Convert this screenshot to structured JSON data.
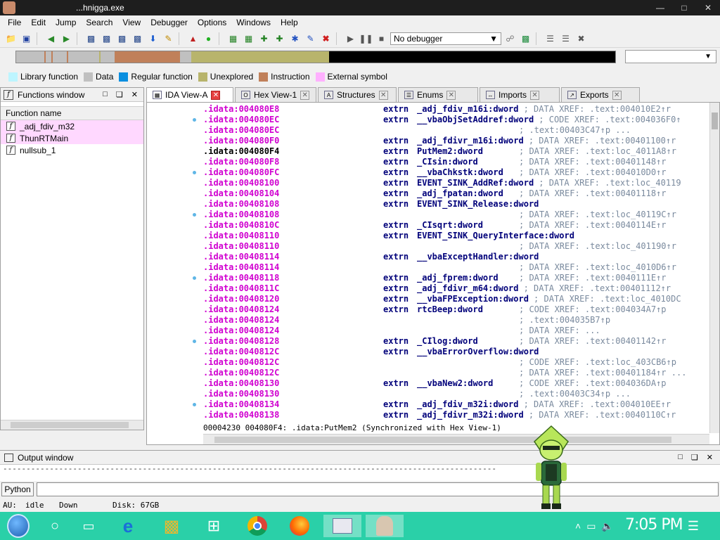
{
  "window": {
    "title": "...hnigga.exe"
  },
  "menu": [
    "File",
    "Edit",
    "Jump",
    "Search",
    "View",
    "Debugger",
    "Options",
    "Windows",
    "Help"
  ],
  "toolbar": {
    "debugger": "No debugger"
  },
  "legend": [
    {
      "label": "Library function",
      "color": "#bdf5ff"
    },
    {
      "label": "Data",
      "color": "#c0c0c0"
    },
    {
      "label": "Regular function",
      "color": "#0a8fe0"
    },
    {
      "label": "Unexplored",
      "color": "#b8b46c"
    },
    {
      "label": "Instruction",
      "color": "#c0805a"
    },
    {
      "label": "External symbol",
      "color": "#ffb0ff"
    }
  ],
  "functions_window": {
    "title": "Functions window",
    "column": "Function name",
    "items": [
      "_adj_fdiv_m32",
      "ThunRTMain",
      "nullsub_1"
    ]
  },
  "tabs": [
    "IDA View-A",
    "Hex View-1",
    "Structures",
    "Enums",
    "Imports",
    "Exports"
  ],
  "code_lines": [
    {
      "addr": ".idata:004080E8",
      "mnem": "extrn",
      "name": "_adj_fdiv_m16i:dword",
      "xref": "; DATA XREF: .text:004010E2↑r",
      "xref_pos": "after"
    },
    {
      "addr": ".idata:004080EC",
      "mnem": "extrn",
      "name": "__vbaObjSetAddref:dword",
      "xref": "; CODE XREF: .text:004036F0↑",
      "xref_pos": "after"
    },
    {
      "addr": ".idata:004080EC",
      "mnem": "",
      "name": "",
      "xref": "; .text:00403C47↑p ...",
      "xref_pos": "col"
    },
    {
      "addr": ".idata:004080F0",
      "mnem": "extrn",
      "name": "_adj_fdivr_m16i:dword",
      "xref": "; DATA XREF: .text:00401100↑r",
      "xref_pos": "after"
    },
    {
      "addr": ".idata:004080F4",
      "mnem": "extrn",
      "name": "PutMem2:dword",
      "xref": "; DATA XREF: .text:loc_4011A8↑r",
      "xref_pos": "col",
      "cursor": true
    },
    {
      "addr": ".idata:004080F8",
      "mnem": "extrn",
      "name": "_CIsin:dword",
      "xref": "; DATA XREF: .text:00401148↑r",
      "xref_pos": "col"
    },
    {
      "addr": ".idata:004080FC",
      "mnem": "extrn",
      "name": "__vbaChkstk:dword",
      "xref": "; DATA XREF: .text:004010D0↑r",
      "xref_pos": "col"
    },
    {
      "addr": ".idata:00408100",
      "mnem": "extrn",
      "name": "EVENT_SINK_AddRef:dword",
      "xref": "; DATA XREF: .text:loc_40119",
      "xref_pos": "after"
    },
    {
      "addr": ".idata:00408104",
      "mnem": "extrn",
      "name": "_adj_fpatan:dword",
      "xref": "; DATA XREF: .text:00401118↑r",
      "xref_pos": "col"
    },
    {
      "addr": ".idata:00408108",
      "mnem": "extrn",
      "name": "EVENT_SINK_Release:dword",
      "xref": "",
      "xref_pos": "col"
    },
    {
      "addr": ".idata:00408108",
      "mnem": "",
      "name": "",
      "xref": "; DATA XREF: .text:loc_40119C↑r",
      "xref_pos": "col"
    },
    {
      "addr": ".idata:0040810C",
      "mnem": "extrn",
      "name": "_CIsqrt:dword",
      "xref": "; DATA XREF: .text:0040114E↑r",
      "xref_pos": "col"
    },
    {
      "addr": ".idata:00408110",
      "mnem": "extrn",
      "name": "EVENT_SINK_QueryInterface:dword",
      "xref": "",
      "xref_pos": "col"
    },
    {
      "addr": ".idata:00408110",
      "mnem": "",
      "name": "",
      "xref": "; DATA XREF: .text:loc_401190↑r",
      "xref_pos": "col"
    },
    {
      "addr": ".idata:00408114",
      "mnem": "extrn",
      "name": "__vbaExceptHandler:dword",
      "xref": "",
      "xref_pos": "col"
    },
    {
      "addr": ".idata:00408114",
      "mnem": "",
      "name": "",
      "xref": "; DATA XREF: .text:loc_4010D6↑r",
      "xref_pos": "col"
    },
    {
      "addr": ".idata:00408118",
      "mnem": "extrn",
      "name": "_adj_fprem:dword",
      "xref": "; DATA XREF: .text:0040111E↑r",
      "xref_pos": "col"
    },
    {
      "addr": ".idata:0040811C",
      "mnem": "extrn",
      "name": "_adj_fdivr_m64:dword",
      "xref": "; DATA XREF: .text:00401112↑r",
      "xref_pos": "after"
    },
    {
      "addr": ".idata:00408120",
      "mnem": "extrn",
      "name": "__vbaFPException:dword",
      "xref": "; DATA XREF: .text:loc_4010DC",
      "xref_pos": "after"
    },
    {
      "addr": ".idata:00408124",
      "mnem": "extrn",
      "name": "rtcBeep:dword",
      "xref": "; CODE XREF: .text:004034A7↑p",
      "xref_pos": "col"
    },
    {
      "addr": ".idata:00408124",
      "mnem": "",
      "name": "",
      "xref": "; .text:004035B7↑p",
      "xref_pos": "col"
    },
    {
      "addr": ".idata:00408124",
      "mnem": "",
      "name": "",
      "xref": "; DATA XREF: ...",
      "xref_pos": "col"
    },
    {
      "addr": ".idata:00408128",
      "mnem": "extrn",
      "name": "_CIlog:dword",
      "xref": "; DATA XREF: .text:00401142↑r",
      "xref_pos": "col"
    },
    {
      "addr": ".idata:0040812C",
      "mnem": "extrn",
      "name": "__vbaErrorOverflow:dword",
      "xref": "",
      "xref_pos": "col"
    },
    {
      "addr": ".idata:0040812C",
      "mnem": "",
      "name": "",
      "xref": "; CODE XREF: .text:loc_403CB6↑p",
      "xref_pos": "col"
    },
    {
      "addr": ".idata:0040812C",
      "mnem": "",
      "name": "",
      "xref": "; DATA XREF: .text:00401184↑r ...",
      "xref_pos": "col"
    },
    {
      "addr": ".idata:00408130",
      "mnem": "extrn",
      "name": "__vbaNew2:dword",
      "xref": "; CODE XREF: .text:004036DA↑p",
      "xref_pos": "col"
    },
    {
      "addr": ".idata:00408130",
      "mnem": "",
      "name": "",
      "xref": "; .text:00403C34↑p ...",
      "xref_pos": "col"
    },
    {
      "addr": ".idata:00408134",
      "mnem": "extrn",
      "name": "_adj_fdiv_m32i:dword",
      "xref": "; DATA XREF: .text:004010EE↑r",
      "xref_pos": "after"
    },
    {
      "addr": ".idata:00408138",
      "mnem": "extrn",
      "name": "_adj_fdivr_m32i:dword",
      "xref": "; DATA XREF: .text:0040110C↑r",
      "xref_pos": "after"
    }
  ],
  "code_status": "00004230 004080F4: .idata:PutMem2 (Synchronized with Hex View-1)",
  "output_window": {
    "title": "Output window",
    "text": "----------------------------------------------------------------------------------------------------------"
  },
  "python_button": "Python",
  "statusbar": {
    "au_label": "AU:",
    "au_state": "idle",
    "direction": "Down",
    "disk": "Disk: 67GB"
  },
  "taskbar": {
    "clock": "7:05 PM"
  },
  "colors": {
    "address": "#d000d0",
    "keyword": "#00007a",
    "comment": "#7a8a9e",
    "taskbar": "#2ad0a8",
    "pink_row": "#ffd8ff"
  }
}
